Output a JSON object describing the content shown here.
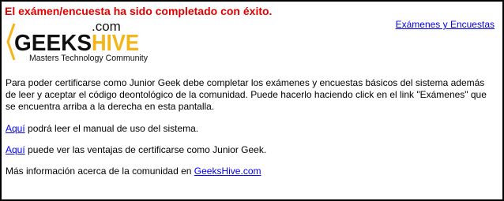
{
  "status": {
    "message": "El exámen/encuesta ha sido completado con éxito."
  },
  "logo": {
    "geeks": "GEEKS",
    "hive": "HIVE",
    "dotcom": ".com",
    "tagline": "Masters Technology Community"
  },
  "nav": {
    "exams_link": "Exámenes y Encuestas"
  },
  "content": {
    "intro": "Para poder certificarse como Junior Geek debe completar los exámenes y encuestas básicos del sistema además de leer y aceptar el código deontológico de la comunidad. Puede hacerlo haciendo click en el link \"Exámenes\" que se encuentra arriba a la derecha en esta pantalla.",
    "manual": {
      "link": "Aquí",
      "text": " podrá leer el manual de uso del sistema."
    },
    "advantages": {
      "link": "Aquí",
      "text": " puede ver las ventajas de certificarse como Junior Geek."
    },
    "more_info": {
      "text": "Más información acerca de la comunidad en ",
      "link": "GeeksHive.com"
    }
  },
  "colors": {
    "status": "#e00000",
    "link": "#0000ee",
    "logo_orange": "#f5b418",
    "logo_dark": "#111111"
  }
}
